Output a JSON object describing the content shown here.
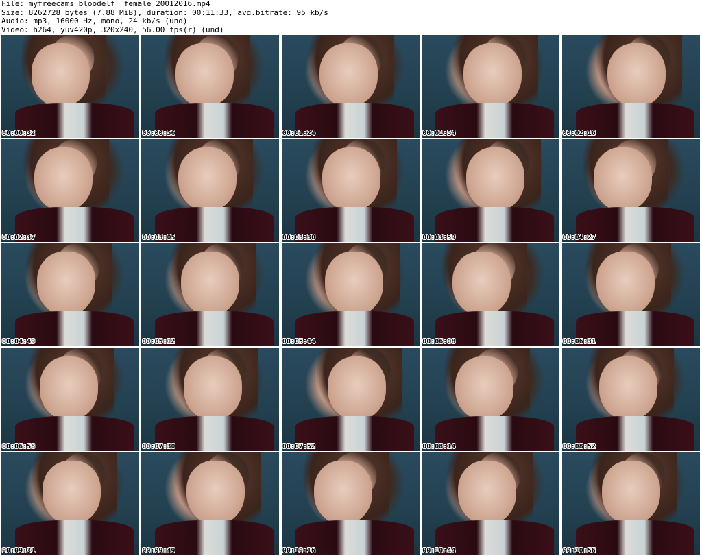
{
  "header": {
    "file_line": "File: myfreecams_bloodelf__female_20012016.mp4",
    "size_line": "Size: 8262728 bytes (7.88 MiB), duration: 00:11:33, avg.bitrate: 95 kb/s",
    "audio_line": "Audio: mp3, 16000 Hz, mono, 24 kb/s (und)",
    "video_line": "Video: h264, yuv420p, 320x240, 56.00 fps(r) (und)"
  },
  "thumbnails": [
    {
      "timestamp": "00:00:32"
    },
    {
      "timestamp": "00:00:56"
    },
    {
      "timestamp": "00:01:24"
    },
    {
      "timestamp": "00:01:54"
    },
    {
      "timestamp": "00:02:16"
    },
    {
      "timestamp": "00:02:37"
    },
    {
      "timestamp": "00:03:05"
    },
    {
      "timestamp": "00:03:30"
    },
    {
      "timestamp": "00:03:59"
    },
    {
      "timestamp": "00:04:27"
    },
    {
      "timestamp": "00:04:49"
    },
    {
      "timestamp": "00:05:12"
    },
    {
      "timestamp": "00:05:44"
    },
    {
      "timestamp": "00:06:08"
    },
    {
      "timestamp": "00:06:31"
    },
    {
      "timestamp": "00:06:58"
    },
    {
      "timestamp": "00:07:30"
    },
    {
      "timestamp": "00:07:52"
    },
    {
      "timestamp": "00:08:14"
    },
    {
      "timestamp": "00:08:52"
    },
    {
      "timestamp": "00:09:31"
    },
    {
      "timestamp": "00:09:49"
    },
    {
      "timestamp": "00:10:16"
    },
    {
      "timestamp": "00:10:44"
    },
    {
      "timestamp": "00:10:56"
    }
  ]
}
